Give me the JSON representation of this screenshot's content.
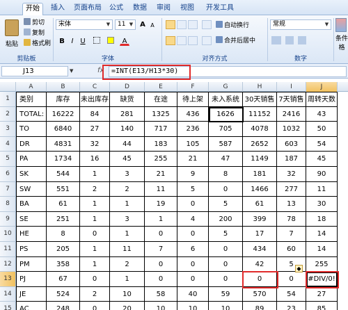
{
  "tabs": [
    "开始",
    "插入",
    "页面布局",
    "公式",
    "数据",
    "审阅",
    "视图",
    "开发工具"
  ],
  "ribbon": {
    "clipboard": {
      "paste": "粘贴",
      "cut": "剪切",
      "copy": "复制",
      "format_painter": "格式刷",
      "label": "剪贴板"
    },
    "font": {
      "name": "宋体",
      "size": "11",
      "bold": "B",
      "italic": "I",
      "underline": "U",
      "grow": "A",
      "shrink": "A",
      "label": "字体",
      "font_color": "A"
    },
    "alignment": {
      "wrap": "自动换行",
      "merge": "合并后居中",
      "label": "对齐方式"
    },
    "number": {
      "format": "常规",
      "label": "数字"
    },
    "styles": {
      "conditional": "条件格"
    }
  },
  "formula_bar": {
    "cell_ref": "J13",
    "fx": "fx",
    "formula": "=INT(E13/H13*30)"
  },
  "columns": [
    "A",
    "B",
    "C",
    "D",
    "E",
    "F",
    "G",
    "H",
    "I",
    "J"
  ],
  "rows": [
    [
      "类别",
      "库存",
      "未出库存",
      "缺货",
      "在途",
      "待上架",
      "未入系统",
      "30天销售",
      "7天销售",
      "周转天数"
    ],
    [
      "TOTAL:",
      "16222",
      "84",
      "281",
      "1325",
      "436",
      "1626",
      "11152",
      "2416",
      "43"
    ],
    [
      "TO",
      "6840",
      "27",
      "140",
      "717",
      "236",
      "705",
      "4078",
      "1032",
      "50"
    ],
    [
      "DR",
      "4831",
      "32",
      "44",
      "183",
      "105",
      "587",
      "2652",
      "603",
      "54"
    ],
    [
      "PA",
      "1734",
      "16",
      "45",
      "255",
      "21",
      "47",
      "1149",
      "187",
      "45"
    ],
    [
      "SK",
      "544",
      "1",
      "3",
      "21",
      "9",
      "8",
      "181",
      "32",
      "90"
    ],
    [
      "SW",
      "551",
      "2",
      "2",
      "11",
      "5",
      "0",
      "1466",
      "277",
      "11"
    ],
    [
      "BA",
      "61",
      "1",
      "1",
      "19",
      "0",
      "5",
      "61",
      "13",
      "30"
    ],
    [
      "SE",
      "251",
      "1",
      "3",
      "1",
      "4",
      "200",
      "399",
      "78",
      "18"
    ],
    [
      "HE",
      "8",
      "0",
      "1",
      "0",
      "0",
      "5",
      "17",
      "7",
      "14"
    ],
    [
      "PS",
      "205",
      "1",
      "11",
      "7",
      "6",
      "0",
      "434",
      "60",
      "14"
    ],
    [
      "PM",
      "358",
      "1",
      "2",
      "0",
      "0",
      "0",
      "42",
      "5",
      "255"
    ],
    [
      "PJ",
      "67",
      "0",
      "1",
      "0",
      "0",
      "0",
      "0",
      "0",
      "#DIV/0!"
    ],
    [
      "JE",
      "524",
      "2",
      "10",
      "58",
      "40",
      "59",
      "570",
      "54",
      "27"
    ],
    [
      "AC",
      "248",
      "0",
      "20",
      "10",
      "10",
      "10",
      "89",
      "23",
      "85"
    ]
  ],
  "row_numbers": [
    "1",
    "2",
    "3",
    "4",
    "5",
    "6",
    "7",
    "8",
    "9",
    "10",
    "11",
    "12",
    "13",
    "14",
    "15"
  ],
  "colors": {
    "highlight_red": "#e02a2a",
    "selected_header": "#f1c15f",
    "ribbon_blue": "#15428b"
  }
}
